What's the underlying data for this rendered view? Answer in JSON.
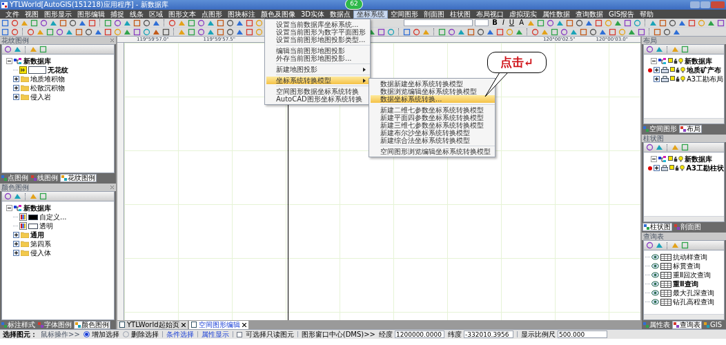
{
  "window": {
    "title": "YTLWorld[AutoGIS(151218)应用程序] - 新数据库",
    "badge": "62"
  },
  "menu": [
    {
      "label": "文件",
      "selected": false
    },
    {
      "label": "视图",
      "selected": false
    },
    {
      "label": "图形显示",
      "selected": false
    },
    {
      "label": "图形编辑",
      "selected": false
    },
    {
      "label": "捕捉",
      "selected": false
    },
    {
      "label": "线条",
      "selected": false
    },
    {
      "label": "区域",
      "selected": false
    },
    {
      "label": "图形文本",
      "selected": false
    },
    {
      "label": "点图形",
      "selected": false
    },
    {
      "label": "图块标注",
      "selected": false
    },
    {
      "label": "颜色及图像",
      "selected": false
    },
    {
      "label": "3D实体",
      "selected": false
    },
    {
      "label": "数据点",
      "selected": false
    },
    {
      "label": "坐标系统",
      "selected": true
    },
    {
      "label": "空间图形",
      "selected": false
    },
    {
      "label": "剖面图",
      "selected": false
    },
    {
      "label": "柱状图",
      "selected": false
    },
    {
      "label": "布局视口",
      "selected": false
    },
    {
      "label": "虚拟现实",
      "selected": false
    },
    {
      "label": "属性数据",
      "selected": false
    },
    {
      "label": "查询数据",
      "selected": false
    },
    {
      "label": "GIS报告",
      "selected": false
    },
    {
      "label": "帮助",
      "selected": false
    }
  ],
  "format_buttons": [
    "B",
    "I",
    "U",
    "A"
  ],
  "ruler_labels": {
    "left": [
      "119°59'57.0\"",
      "119°59'57.5\""
    ],
    "right": [
      "120°00'02.5\"",
      "120°00'03.0\""
    ]
  },
  "dropdown": [
    {
      "kind": "item",
      "label": "设置当前数据库坐标系统...",
      "selected": false
    },
    {
      "kind": "item",
      "label": "设置当前图形为数字平面图形",
      "selected": false
    },
    {
      "kind": "item",
      "label": "设置当前图形地图投影类型...",
      "selected": false
    },
    {
      "kind": "separator"
    },
    {
      "kind": "item",
      "label": "编辑当前图形地图投影",
      "selected": false
    },
    {
      "kind": "item",
      "label": "外存当前图形地图投影...",
      "selected": false
    },
    {
      "kind": "separator"
    },
    {
      "kind": "submenu",
      "label": "新建地图投影",
      "selected": false
    },
    {
      "kind": "separator"
    },
    {
      "kind": "submenu",
      "label": "坐标系统转换模型",
      "selected": true
    },
    {
      "kind": "separator"
    },
    {
      "kind": "item",
      "label": "空间图形数据坐标系统转换",
      "selected": false
    },
    {
      "kind": "item",
      "label": "AutoCAD图形坐标系统转换",
      "selected": false
    }
  ],
  "submenu": [
    {
      "kind": "item",
      "label": "数据新建坐标系统转换模型",
      "selected": false
    },
    {
      "kind": "item",
      "label": "数据浏览编辑坐标系统转换模型",
      "selected": false
    },
    {
      "kind": "item",
      "label": "数据坐标系统转换...",
      "selected": true
    },
    {
      "kind": "separator"
    },
    {
      "kind": "item",
      "label": "新建二维七参数坐标系统转换模型",
      "selected": false
    },
    {
      "kind": "item",
      "label": "新建平面四参数坐标系统转换模型",
      "selected": false
    },
    {
      "kind": "item",
      "label": "新建三维七参数坐标系统转换模型",
      "selected": false
    },
    {
      "kind": "item",
      "label": "新建布尔沙坐标系统转换模型",
      "selected": false
    },
    {
      "kind": "item",
      "label": "新建综合法坐标系统转换模型",
      "selected": false
    },
    {
      "kind": "separator"
    },
    {
      "kind": "item",
      "label": "空间图形浏览编辑坐标系统转换模型",
      "selected": false
    }
  ],
  "callout": "点击↵",
  "left_panels": [
    {
      "title": "花纹图例",
      "tree": [
        {
          "kind": "database",
          "label": "新数据库",
          "bold": true,
          "expanded": true,
          "children": [
            {
              "kind": "pattern",
              "label": "无花纹",
              "bold": true,
              "color": "#ffffff"
            },
            {
              "kind": "folder",
              "label": "地质堆积物",
              "bold": false,
              "expanded": false
            },
            {
              "kind": "folder",
              "label": "松散沉积物",
              "bold": false,
              "expanded": false
            },
            {
              "kind": "folder",
              "label": "侵入岩",
              "bold": false,
              "expanded": false
            }
          ]
        }
      ],
      "tabs": [
        {
          "label": "点图例",
          "selected": false
        },
        {
          "label": "线图例",
          "selected": false
        },
        {
          "label": "花纹图例",
          "selected": true
        }
      ]
    },
    {
      "title": "颜色图例",
      "tree": [
        {
          "kind": "database",
          "label": "新数据库",
          "bold": true,
          "expanded": true,
          "children": [
            {
              "kind": "color",
              "label": "自定义...",
              "bold": false,
              "color": "#000000"
            },
            {
              "kind": "color",
              "label": "透明",
              "bold": false,
              "color": "#ffffff"
            },
            {
              "kind": "folder",
              "label": "通用",
              "bold": true,
              "expanded": false
            },
            {
              "kind": "folder",
              "label": "第四系",
              "bold": false,
              "expanded": false
            },
            {
              "kind": "folder",
              "label": "侵入体",
              "bold": false,
              "expanded": false
            }
          ]
        }
      ],
      "tabs": [
        {
          "label": "标注样式",
          "selected": false
        },
        {
          "label": "字体图例",
          "selected": false
        },
        {
          "label": "颜色图例",
          "selected": true
        }
      ]
    }
  ],
  "right_panels": [
    {
      "title": "布局",
      "tree": [
        {
          "kind": "database",
          "label": "新数据库",
          "bold": true,
          "expanded": true,
          "active": false,
          "children": [
            {
              "kind": "layout",
              "label": "地质矿产布",
              "bold": true,
              "expanded": false,
              "active": true
            },
            {
              "kind": "layout",
              "label": "A3工勘布局",
              "bold": false,
              "expanded": false,
              "active": false
            }
          ]
        }
      ],
      "tabs": [
        {
          "label": "空间图形",
          "selected": false
        },
        {
          "label": "布局",
          "selected": true
        }
      ]
    },
    {
      "title": "柱状图",
      "tree": [
        {
          "kind": "database",
          "label": "新数据库",
          "bold": true,
          "expanded": true,
          "active": false,
          "children": [
            {
              "kind": "layout",
              "label": "A3工勘柱状",
              "bold": true,
              "expanded": false,
              "active": true
            }
          ]
        }
      ],
      "tabs": [
        {
          "label": "柱状图",
          "selected": true
        },
        {
          "label": "剖面图",
          "selected": false
        }
      ]
    },
    {
      "title": "查询表",
      "tree": [
        {
          "kind": "query",
          "label": "抗动样查询",
          "bold": false
        },
        {
          "kind": "query",
          "label": "标贯查询",
          "bold": false
        },
        {
          "kind": "query",
          "label": "重Ⅱ回次查询",
          "bold": false
        },
        {
          "kind": "query",
          "label": "重Ⅱ查询",
          "bold": true
        },
        {
          "kind": "query",
          "label": "最大孔深查询",
          "bold": false
        },
        {
          "kind": "query",
          "label": "钻孔高程查询",
          "bold": false
        }
      ],
      "tabs": [
        {
          "label": "属性表",
          "selected": false
        },
        {
          "label": "查询表",
          "selected": true
        },
        {
          "label": "GIS",
          "selected": false
        }
      ]
    }
  ],
  "document_tabs": [
    {
      "label": "YTLWorld起始页",
      "selected": false
    },
    {
      "label": "空间图形编辑",
      "selected": true
    }
  ],
  "status_bar": {
    "label": "选择图元：",
    "mouse_label": "鼠标操作>>",
    "radios": [
      {
        "label": "增加选择",
        "selected": true
      },
      {
        "label": "删除选择",
        "selected": false
      }
    ],
    "links": [
      "条件选择",
      "属性显示"
    ],
    "checkbox": {
      "label": "可选择只读图元",
      "checked": false
    },
    "center_label": "图形窗口中心(DMS)>>",
    "fields": [
      {
        "label": "经度",
        "value": "1200000.0000"
      },
      {
        "label": "纬度",
        "value": "-332010.3956"
      },
      {
        "label": "显示比例尺",
        "value": "500.000"
      }
    ]
  }
}
